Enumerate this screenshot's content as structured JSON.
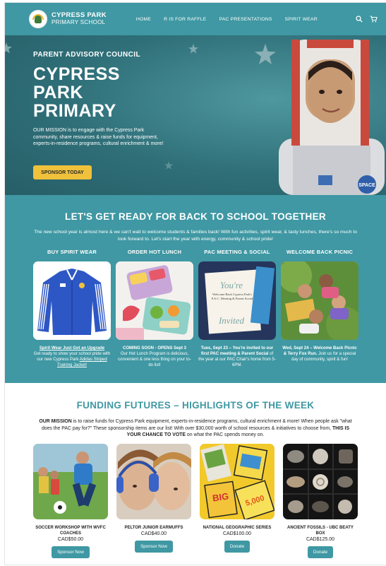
{
  "nav": {
    "brand_line1": "CYPRESS PARK",
    "brand_line2": "PRIMARY SCHOOL",
    "menu": [
      {
        "label": "HOME"
      },
      {
        "label": "R IS FOR RAFFLE"
      },
      {
        "label": "PAC PRESENTATIONS"
      },
      {
        "label": "SPIRIT WEAR"
      }
    ],
    "icons": [
      "search-icon",
      "cart-icon"
    ]
  },
  "hero": {
    "eyebrow": "PARENT ADVISORY COUNCIL",
    "title_line1": "CYPRESS",
    "title_line2": "PARK",
    "title_line3": "PRIMARY",
    "mission": "OUR MISSION is to engage with the Cypress Park community, share resources & raise funds for equipment, experts-in-residence programs, cultural enrichment & more!",
    "cta": "SPONSOR TODAY",
    "badge_text": "SPACE"
  },
  "bts": {
    "title": "LET'S GET READY FOR BACK TO SCHOOL TOGETHER",
    "intro": "The new school year is almost here & we can't wait to welcome students & families back! With fun activities, spirit wear, & tasty lunches, there's so much to look forward to. Let's start the year with energy, community & school pride!",
    "columns": [
      {
        "heading": "BUY SPIRIT WEAR",
        "link": "Spirit Wear Just Got an Upgrade",
        "caption": "Get ready to show your school pride with our new Cypress Park",
        "caption_link": "Adidas Striped Training Jacket!"
      },
      {
        "heading": "ORDER HOT LUNCH",
        "bold": "COMING SOON - OPENS Sept 3",
        "caption": "Our Hot Lunch Program is delicious, convenient & one less thing on your to-do list!"
      },
      {
        "heading": "PAC MEETING & SOCIAL",
        "card_title": "You're",
        "card_lines": "Welcome Back Cypress Park's P.A.C. Meeting & Parent Social",
        "card_bottom": "Invited",
        "bold": "Tues, Sept 23 – You're invited to our first PAC meeting & Parent Social",
        "caption": "of the year at our PAC Chair's home from 5-6PM."
      },
      {
        "heading": "WELCOME BACK PICNIC",
        "bold": "Wed, Sept 24 – Welcome Back Picnic & Terry Fox Run.",
        "caption": "Join us for a special day of community, spirit & fun!"
      }
    ]
  },
  "fund": {
    "title": "FUNDING FUTURES – HIGHLIGHTS OF THE WEEK",
    "intro_bold1": "OUR MISSION",
    "intro_part1": " is to raise funds for Cypress Park equipment, experts-in-residence programs, cultural enrichment & more! When people ask \"what does the PAC pay for?\" These sponsorship items are our list! With over $30,000 worth of school resources & initiatives to choose from, ",
    "intro_bold2": "THIS IS YOUR CHANCE TO VOTE",
    "intro_part2": " on what the PAC spends money on.",
    "cards": [
      {
        "name": "SOCCER WORKSHOP WITH WVFC COACHES",
        "price": "CAD$50.00",
        "button": "Sponsor Now"
      },
      {
        "name": "PELTOR JUNIOR EARMUFFS",
        "price": "CAD$40.00",
        "button": "Sponsor Now"
      },
      {
        "name": "NATIONAL GEOGRAPHIC SERIES",
        "price": "CAD$100.00",
        "button": "Donate",
        "book_big": "BIG",
        "book_num": "5,000"
      },
      {
        "name": "ANCIENT FOSSILS - UBC BEATY BOX",
        "price": "CAD$125.00",
        "button": "Donate"
      }
    ]
  }
}
